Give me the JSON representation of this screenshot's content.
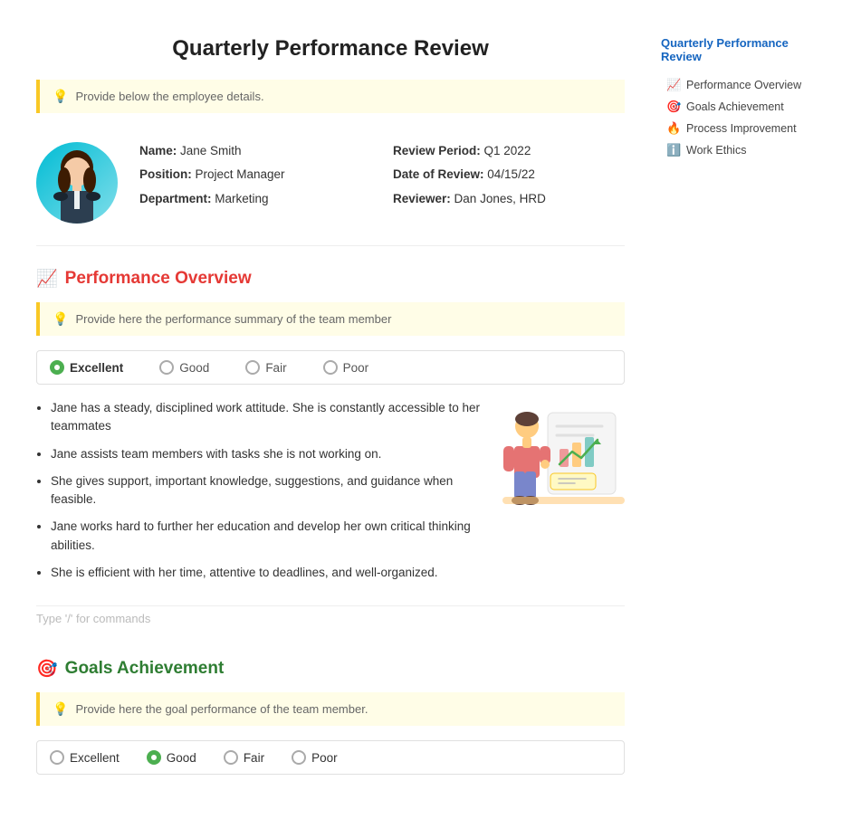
{
  "page": {
    "title": "Quarterly Performance Review"
  },
  "top_banner": {
    "text": "Provide below the employee details.",
    "icon": "💡"
  },
  "employee": {
    "name_label": "Name:",
    "name_value": "Jane Smith",
    "position_label": "Position:",
    "position_value": "Project Manager",
    "department_label": "Department:",
    "department_value": "Marketing",
    "review_period_label": "Review Period:",
    "review_period_value": "Q1 2022",
    "date_label": "Date of Review:",
    "date_value": "04/15/22",
    "reviewer_label": "Reviewer:",
    "reviewer_value": "Dan Jones, HRD"
  },
  "performance_section": {
    "icon": "📈",
    "title": "Performance Overview",
    "banner_text": "Provide here the performance summary of the team member",
    "banner_icon": "💡",
    "ratings": [
      {
        "label": "Excellent",
        "selected": true
      },
      {
        "label": "Good",
        "selected": false
      },
      {
        "label": "Fair",
        "selected": false
      },
      {
        "label": "Poor",
        "selected": false
      }
    ],
    "bullets": [
      "Jane has a steady, disciplined work attitude. She is constantly accessible to her teammates",
      "Jane assists team members with tasks she is not working on.",
      "She gives support, important knowledge, suggestions, and guidance when feasible.",
      "Jane works hard to further her education and develop her own critical thinking abilities.",
      "She is efficient with her time, attentive to deadlines, and well-organized."
    ],
    "type_hint": "Type '/' for commands"
  },
  "goals_section": {
    "icon": "🎯",
    "title": "Goals Achievement",
    "banner_text": "Provide here the goal performance of the team member.",
    "banner_icon": "💡",
    "ratings": [
      {
        "label": "Excellent",
        "selected": false
      },
      {
        "label": "Good",
        "selected": true
      },
      {
        "label": "Fair",
        "selected": false
      },
      {
        "label": "Poor",
        "selected": false
      }
    ]
  },
  "sidebar": {
    "title": "Quarterly Performance Review",
    "items": [
      {
        "icon": "📈",
        "label": "Performance Overview"
      },
      {
        "icon": "🎯",
        "label": "Goals Achievement"
      },
      {
        "icon": "🔥",
        "label": "Process Improvement"
      },
      {
        "icon": "ℹ️",
        "label": "Work Ethics"
      }
    ]
  }
}
